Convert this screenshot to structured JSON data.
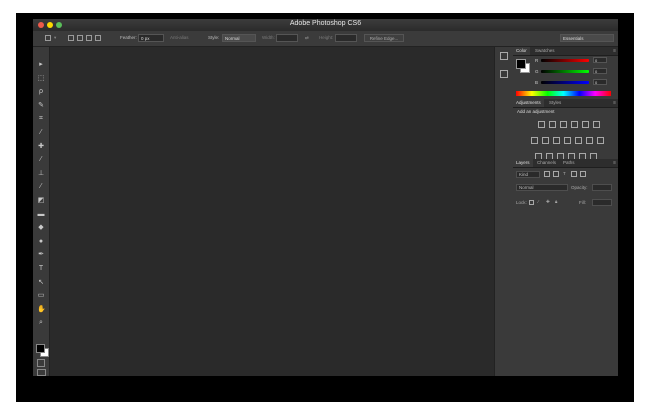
{
  "window": {
    "title": "Adobe Photoshop CS6"
  },
  "traffic_lights": {
    "close": "#ed594a",
    "minimize": "#fdd800",
    "zoom": "#5ac05a"
  },
  "options_bar": {
    "feather_label": "Feather:",
    "feather_value": "0 px",
    "antialias_label": "Anti-alias",
    "style_label": "Style:",
    "style_value": "Normal",
    "width_label": "Width:",
    "height_label": "Height:",
    "refine_edge_label": "Refine Edge...",
    "workspace_value": "Essentials"
  },
  "toolbar": {
    "tools": [
      {
        "name": "move-tool-icon",
        "glyph": "▸"
      },
      {
        "name": "marquee-tool-icon",
        "glyph": "⬚"
      },
      {
        "name": "lasso-tool-icon",
        "glyph": "ρ"
      },
      {
        "name": "quick-select-tool-icon",
        "glyph": "✎"
      },
      {
        "name": "crop-tool-icon",
        "glyph": "⌗"
      },
      {
        "name": "eyedropper-tool-icon",
        "glyph": "⁄"
      },
      {
        "name": "healing-brush-tool-icon",
        "glyph": "✚"
      },
      {
        "name": "brush-tool-icon",
        "glyph": "⁄"
      },
      {
        "name": "clone-stamp-tool-icon",
        "glyph": "⊥"
      },
      {
        "name": "history-brush-tool-icon",
        "glyph": "⁄"
      },
      {
        "name": "eraser-tool-icon",
        "glyph": "◩"
      },
      {
        "name": "gradient-tool-icon",
        "glyph": "▬"
      },
      {
        "name": "blur-tool-icon",
        "glyph": "◆"
      },
      {
        "name": "dodge-tool-icon",
        "glyph": "●"
      },
      {
        "name": "pen-tool-icon",
        "glyph": "✒"
      },
      {
        "name": "type-tool-icon",
        "glyph": "T"
      },
      {
        "name": "path-selection-tool-icon",
        "glyph": "↖"
      },
      {
        "name": "rectangle-tool-icon",
        "glyph": "▭"
      },
      {
        "name": "hand-tool-icon",
        "glyph": "✋"
      },
      {
        "name": "zoom-tool-icon",
        "glyph": "⌕"
      }
    ]
  },
  "panels": {
    "color_tabs": [
      "Color",
      "Swatches"
    ],
    "color_sliders": [
      {
        "label": "R",
        "value": "0"
      },
      {
        "label": "G",
        "value": "0"
      },
      {
        "label": "B",
        "value": "0"
      }
    ],
    "adjustment_tabs": [
      "Adjustments",
      "Styles"
    ],
    "add_adjustment_label": "Add an adjustment",
    "layers_tabs": [
      "Layers",
      "Channels",
      "Paths"
    ],
    "layers_kind_label": "Kind",
    "layers_blend_value": "Normal",
    "opacity_label": "Opacity:",
    "lock_label": "Lock:",
    "fill_label": "Fill:"
  }
}
